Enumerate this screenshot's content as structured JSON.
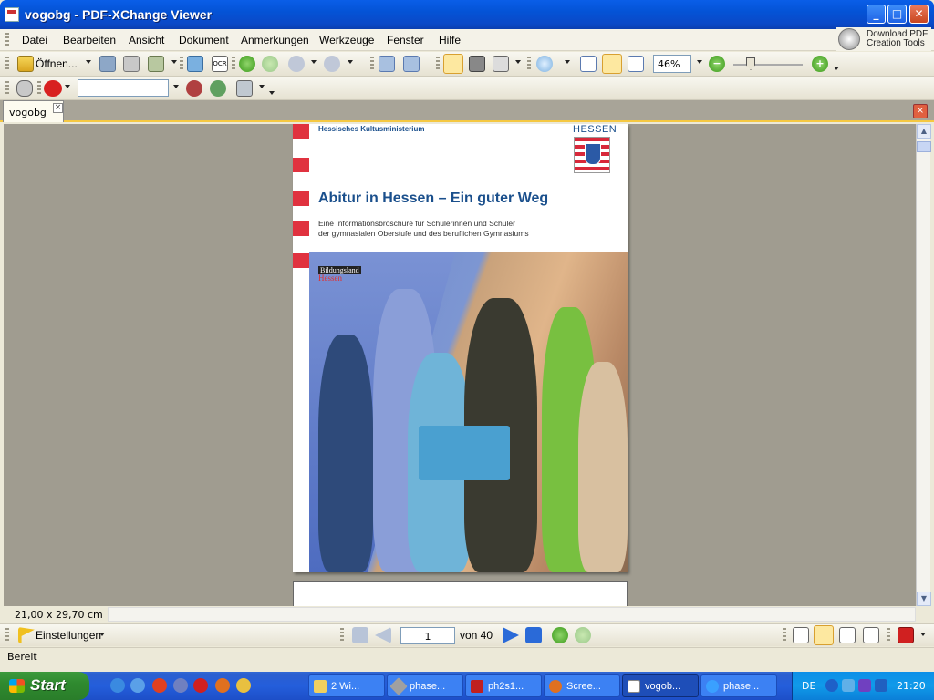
{
  "window": {
    "title": "vogobg - PDF-XChange Viewer",
    "minimize": "_",
    "maximize": "□",
    "close": "✕"
  },
  "menu": [
    "Datei",
    "Bearbeiten",
    "Ansicht",
    "Dokument",
    "Anmerkungen",
    "Werkzeuge",
    "Fenster",
    "Hilfe"
  ],
  "download": {
    "line1": "Download PDF",
    "line2": "Creation Tools"
  },
  "toolbar": {
    "open_label": "Öffnen...",
    "ocr_label": "OCR",
    "zoom_value": "46%",
    "zoom_in": "+",
    "zoom_out": "−"
  },
  "tab": {
    "label": "vogobg",
    "close": "×"
  },
  "document": {
    "ministry": "Hessisches Kultusministerium",
    "state": "HESSEN",
    "title": "Abitur in Hessen – Ein guter Weg",
    "subtitle_1": "Eine Informationsbroschüre für Schülerinnen und Schüler",
    "subtitle_2": "der gymnasialen Oberstufe und des beruflichen Gymnasiums",
    "brand_1": "Bildungsland",
    "brand_2": "Hessen"
  },
  "status": {
    "page_size": "21,00 x 29,70 cm",
    "settings_label": "Einstellungen",
    "current_page": "1",
    "page_of": "von 40",
    "ready": "Bereit"
  },
  "taskbar": {
    "start": "Start",
    "tasks": [
      "2 Wi...",
      "phase...",
      "ph2s1...",
      "Scree...",
      "vogob...",
      "phase..."
    ],
    "lang": "DE",
    "time": "21:20"
  },
  "colors": {
    "title_blue": "#0453d6",
    "doc_blue": "#1a4f8c",
    "hessen_red": "#e0323f",
    "start_green": "#2f8a2f"
  }
}
